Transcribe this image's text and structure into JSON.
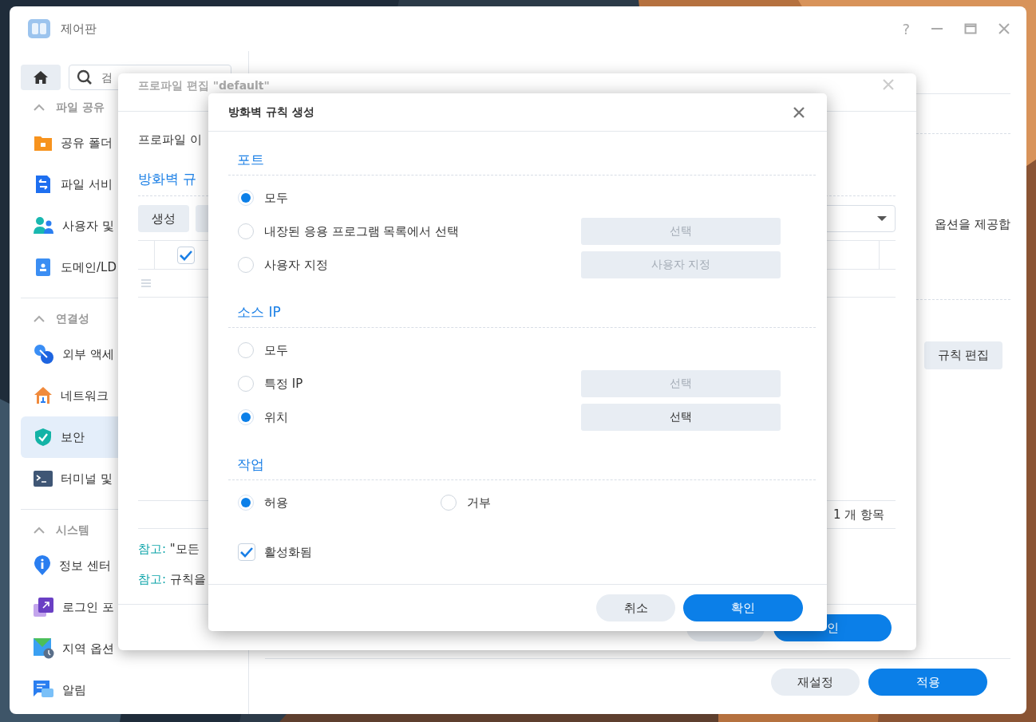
{
  "window": {
    "title": "제어판",
    "help_glyph": "?"
  },
  "sidebar": {
    "search": {
      "placeholder": "검"
    },
    "sections": [
      {
        "title": "파일 공유",
        "expanded": true,
        "items": [
          {
            "label": "공유 폴더",
            "kind": "folder",
            "selected": false
          },
          {
            "label": "파일 서비",
            "kind": "transfer",
            "selected": false
          },
          {
            "label": "사용자 및",
            "kind": "users",
            "selected": false
          },
          {
            "label": "도메인/LD",
            "kind": "contact",
            "selected": false
          }
        ]
      },
      {
        "title": "연결성",
        "expanded": true,
        "items": [
          {
            "label": "외부 액세",
            "kind": "link",
            "selected": false
          },
          {
            "label": "네트워크",
            "kind": "house",
            "selected": false
          },
          {
            "label": "보안",
            "kind": "shield",
            "selected": true
          },
          {
            "label": "터미널 및",
            "kind": "terminal",
            "selected": false
          }
        ]
      },
      {
        "title": "시스템",
        "expanded": true,
        "items": [
          {
            "label": "정보 센터",
            "kind": "info",
            "selected": false
          },
          {
            "label": "로그인 포",
            "kind": "login",
            "selected": false
          },
          {
            "label": "지역 옵션",
            "kind": "region",
            "selected": false
          },
          {
            "label": "알림",
            "kind": "chat",
            "selected": false
          }
        ]
      }
    ]
  },
  "main": {
    "description": "옵션을 제공합",
    "edit_button": "규칙 편집",
    "footer_buttons": [
      {
        "label": "재설정",
        "kind": "secondary"
      },
      {
        "label": "적용",
        "kind": "primary"
      }
    ]
  },
  "profile_dialog": {
    "title": "프로파일 편집 \"default\"",
    "name_label": "프로파일 이",
    "rules_heading": "방화벽 규",
    "create_button": "생성",
    "header_checkbox": {
      "checked": true
    },
    "count": "1 개 항목",
    "notes": [
      {
        "prefix": "참고:",
        "text": "\"모든"
      },
      {
        "prefix": "참고:",
        "text": "규칙을"
      }
    ],
    "confirm_button": "인"
  },
  "rule_dialog": {
    "title": "방화벽 규칙 생성",
    "sections": [
      {
        "title": "포트",
        "kind": "column",
        "options": [
          {
            "label": "모두",
            "selected": true
          },
          {
            "label": "내장된 응용 프로그램 목록에서 선택",
            "selected": false,
            "button": {
              "label": "선택",
              "disabled": true
            }
          },
          {
            "label": "사용자 지정",
            "selected": false,
            "button": {
              "label": "사용자 지정",
              "disabled": true
            }
          }
        ]
      },
      {
        "title": "소스 IP",
        "kind": "column",
        "options": [
          {
            "label": "모두",
            "selected": false
          },
          {
            "label": "특정 IP",
            "selected": false,
            "button": {
              "label": "선택",
              "disabled": true
            }
          },
          {
            "label": "위치",
            "selected": true,
            "button": {
              "label": "선택",
              "disabled": false
            }
          }
        ]
      },
      {
        "title": "작업",
        "kind": "row",
        "options": [
          {
            "label": "허용",
            "selected": true
          },
          {
            "label": "거부",
            "selected": false
          }
        ]
      }
    ],
    "enabled": {
      "label": "활성화됨",
      "checked": true
    },
    "buttons": [
      {
        "label": "취소",
        "kind": "secondary"
      },
      {
        "label": "확인",
        "kind": "primary"
      }
    ]
  }
}
